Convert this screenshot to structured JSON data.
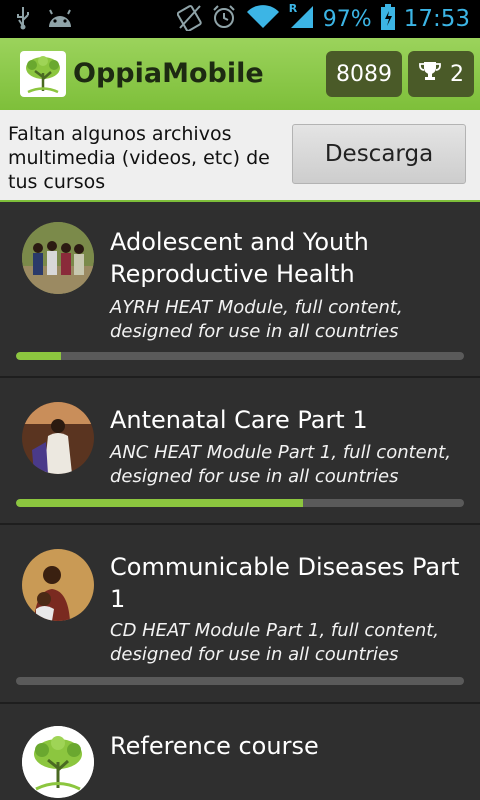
{
  "status_bar": {
    "battery_percent": "97%",
    "time": "17:53",
    "roaming_indicator": "R",
    "icons": [
      "usb-icon",
      "android-icon",
      "no-sim-icon",
      "alarm-icon",
      "wifi-icon",
      "signal-icon",
      "battery-icon"
    ]
  },
  "action_bar": {
    "title": "OppiaMobile",
    "points": "8089",
    "badges": "2",
    "icons": [
      "oppia-tree-logo-icon",
      "trophy-icon"
    ]
  },
  "banner": {
    "message": "Faltan algunos archivos multimedia (videos, etc) de tus cursos",
    "button_label": "Descarga"
  },
  "courses": [
    {
      "title": "Adolescent and Youth Reproductive Health",
      "description": "AYRH HEAT Module, full content, designed for use in all countries",
      "progress": 0.1
    },
    {
      "title": "Antenatal Care Part 1",
      "description": "ANC HEAT Module Part 1, full content, designed for use in all countries",
      "progress": 0.64
    },
    {
      "title": "Communicable Diseases Part 1",
      "description": "CD HEAT Module Part 1, full content, designed for use in all countries",
      "progress": 0.0
    },
    {
      "title": "Reference course",
      "description": "",
      "progress": null
    }
  ],
  "colors": {
    "action_bar": "#8cc63f",
    "progress_fill": "#8cc63f",
    "badge_bg": "#4a5a28",
    "status_icons": "#3cb5e5"
  }
}
